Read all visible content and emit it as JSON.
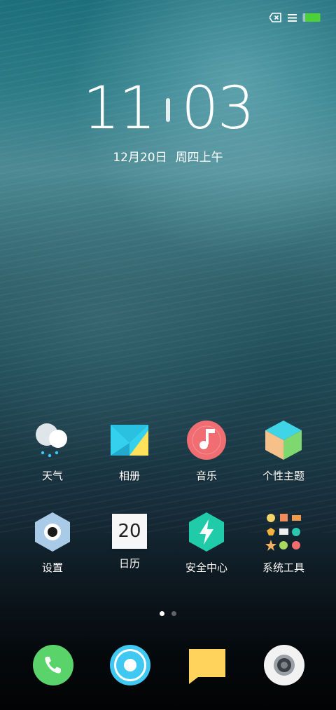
{
  "status_bar": {
    "icons": [
      "no-sim-icon",
      "signal-menu-icon",
      "battery-icon"
    ],
    "battery_color": "#4cd137"
  },
  "clock": {
    "hour": "11",
    "minute": "03",
    "date": "12月20日",
    "weekday": "周四上午"
  },
  "apps": [
    {
      "label": "天气",
      "icon": "weather-icon"
    },
    {
      "label": "相册",
      "icon": "gallery-icon"
    },
    {
      "label": "音乐",
      "icon": "music-icon"
    },
    {
      "label": "个性主题",
      "icon": "themes-icon"
    },
    {
      "label": "设置",
      "icon": "settings-icon"
    },
    {
      "label": "日历",
      "icon": "calendar-icon",
      "badge": "20"
    },
    {
      "label": "安全中心",
      "icon": "security-icon"
    },
    {
      "label": "系统工具",
      "icon": "tools-folder-icon"
    }
  ],
  "pager": {
    "pages": 2,
    "current": 1
  },
  "dock": [
    {
      "icon": "phone-icon",
      "color": "#5bd36b"
    },
    {
      "icon": "browser-icon",
      "color": "#3fc9f2"
    },
    {
      "icon": "messages-icon",
      "color": "#ffd35c"
    },
    {
      "icon": "camera-icon",
      "color": "#f2f2f2"
    }
  ]
}
